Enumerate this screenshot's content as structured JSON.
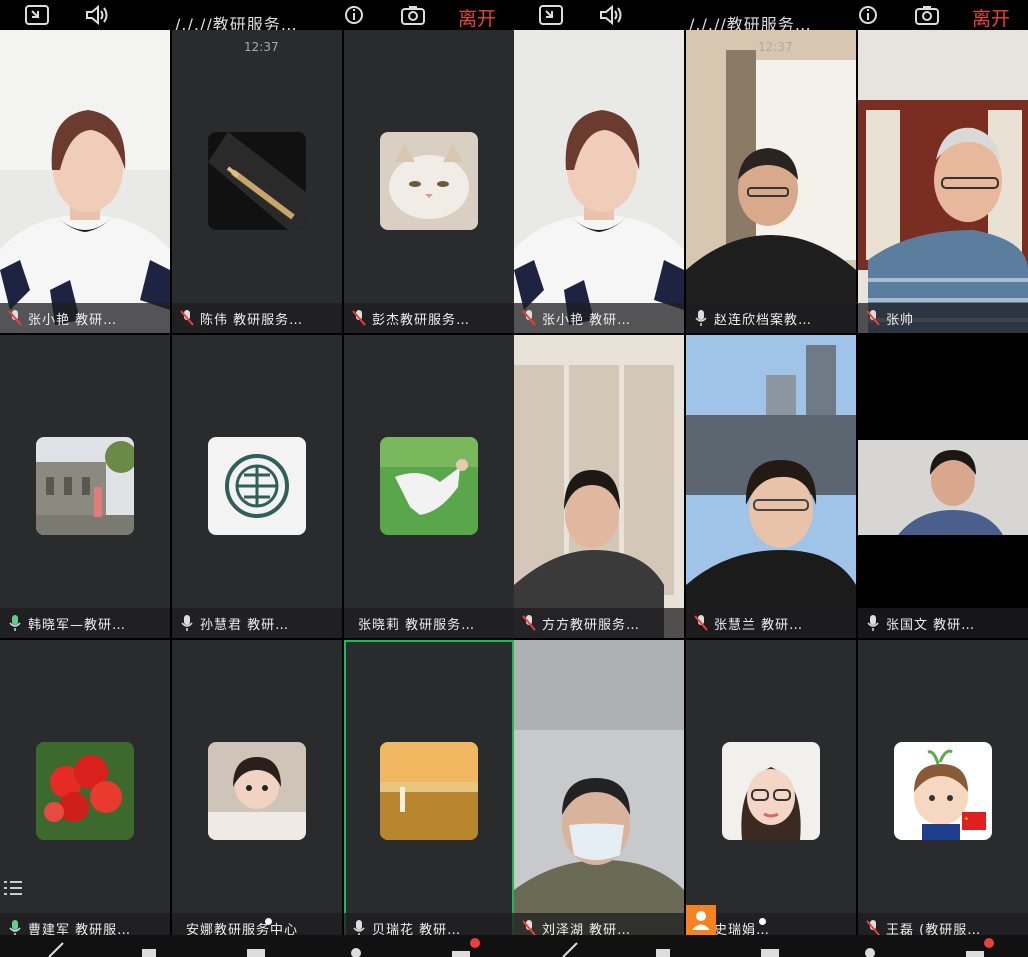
{
  "left": {
    "title": "/././/教研服务…",
    "time": "12:37",
    "leave_label": "离开",
    "tiles": [
      {
        "name": "张小艳  教研…",
        "mic": "muted",
        "kind": "video-woman"
      },
      {
        "name": "陈伟 教研服务…",
        "mic": "muted",
        "kind": "avatar-pen"
      },
      {
        "name": "彭杰教研服务…",
        "mic": "muted",
        "kind": "avatar-cat"
      },
      {
        "name": "韩晓军—教研…",
        "mic": "on",
        "kind": "avatar-wall"
      },
      {
        "name": "孙慧君  教研…",
        "mic": "on",
        "kind": "avatar-logo"
      },
      {
        "name": "张晓莉  教研服务…",
        "mic": "none",
        "kind": "avatar-yoga"
      },
      {
        "name": "曹建军 教研服…",
        "mic": "on",
        "kind": "avatar-flower"
      },
      {
        "name": "安娜教研服务中心",
        "mic": "none",
        "kind": "avatar-baby"
      },
      {
        "name": "贝瑞花    教研…",
        "mic": "on",
        "kind": "avatar-field"
      }
    ]
  },
  "right": {
    "title": "/././/教研服务…",
    "time": "12:37",
    "leave_label": "离开",
    "tiles": [
      {
        "name": "张小艳  教研…",
        "mic": "muted",
        "kind": "video-woman"
      },
      {
        "name": "赵连欣档案教…",
        "mic": "on",
        "kind": "video-man1"
      },
      {
        "name": "张帅",
        "mic": "muted",
        "kind": "video-man2"
      },
      {
        "name": "方方教研服务…",
        "mic": "muted",
        "kind": "video-woman2"
      },
      {
        "name": "张慧兰    教研…",
        "mic": "muted",
        "kind": "video-woman3"
      },
      {
        "name": "张国文  教研…",
        "mic": "on",
        "kind": "video-man3"
      },
      {
        "name": "刘泽湖  教研…",
        "mic": "muted",
        "kind": "video-car"
      },
      {
        "name": "史瑞娟…",
        "mic": "muted",
        "kind": "avatar-cartoon-girl"
      },
      {
        "name": "王磊 (教研服…",
        "mic": "muted",
        "kind": "avatar-cartoon-boy"
      }
    ]
  },
  "colors": {
    "accent_leave": "#e9413a",
    "speaking_border": "#1db954",
    "tile_bg": "#2a2b2d"
  }
}
